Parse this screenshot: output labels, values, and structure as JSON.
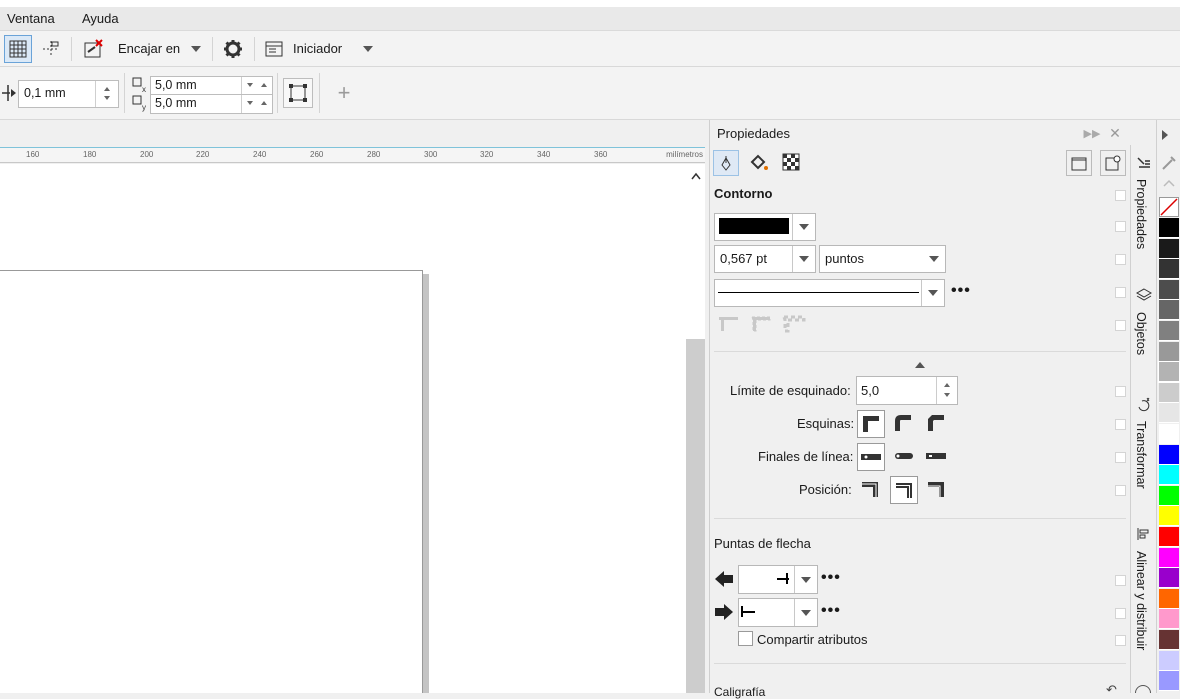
{
  "menu": {
    "items": [
      "Ventana",
      "Ayuda"
    ]
  },
  "toolbar1": {
    "snap_label": "Encajar en",
    "launcher_label": "Iniciador"
  },
  "toolbar2": {
    "nudge_value": "0,1 mm",
    "dup_x": "5,0 mm",
    "dup_y": "5,0 mm"
  },
  "ruler": {
    "ticks": [
      "160",
      "180",
      "200",
      "220",
      "240",
      "260",
      "280",
      "300",
      "320",
      "340",
      "360"
    ],
    "unit": "milímetros"
  },
  "panel": {
    "title": "Propiedades",
    "section_outline": "Contorno",
    "width_value": "0,567 pt",
    "units_value": "puntos",
    "more_label": "•••",
    "miter_label": "Límite de esquinado:",
    "miter_value": "5,0",
    "corners_label": "Esquinas:",
    "caps_label": "Finales de línea:",
    "position_label": "Posición:",
    "arrows_title": "Puntas de flecha",
    "share_label": "Compartir atributos",
    "calligraphy_label": "Caligrafía"
  },
  "docker_tabs": [
    "Propiedades",
    "Objetos",
    "Transformar",
    "Alinear y distribuir"
  ],
  "palette": {
    "colors": [
      "#000000",
      "#1a1a1a",
      "#333333",
      "#4d4d4d",
      "#666666",
      "#808080",
      "#999999",
      "#b3b3b3",
      "#cccccc",
      "#e6e6e6",
      "#ffffff",
      "#0000ff",
      "#00ffff",
      "#00ff00",
      "#ffff00",
      "#ff0000",
      "#ff00ff",
      "#9900cc",
      "#ff6600",
      "#ff99cc",
      "#663333",
      "#ccccff",
      "#9999ff"
    ]
  }
}
